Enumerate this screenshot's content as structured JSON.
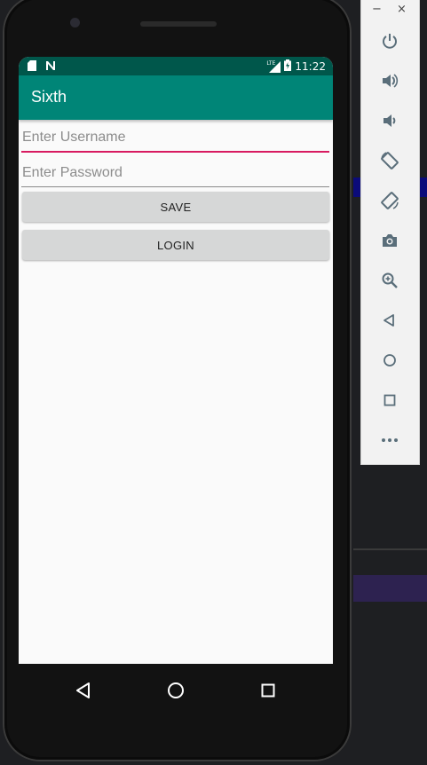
{
  "statusbar": {
    "network": "LTE",
    "time": "11:22"
  },
  "app": {
    "title": "Sixth"
  },
  "form": {
    "username_placeholder": "Enter Username",
    "password_placeholder": "Enter Password",
    "save_label": "SAVE",
    "login_label": "LOGIN"
  },
  "colors": {
    "status_bar": "#00574B",
    "app_bar": "#008577",
    "accent": "#D81B60",
    "button": "#D6D7D7"
  },
  "navbar": {
    "items": [
      "back-icon",
      "home-icon",
      "recents-icon"
    ]
  },
  "emulator_panel": {
    "window_controls": [
      "−",
      "×"
    ],
    "tools": [
      "power-icon",
      "volume-up-icon",
      "volume-down-icon",
      "rotate-left-icon",
      "rotate-right-icon",
      "camera-icon",
      "zoom-icon",
      "back-icon",
      "home-icon",
      "overview-icon",
      "more-icon"
    ]
  }
}
